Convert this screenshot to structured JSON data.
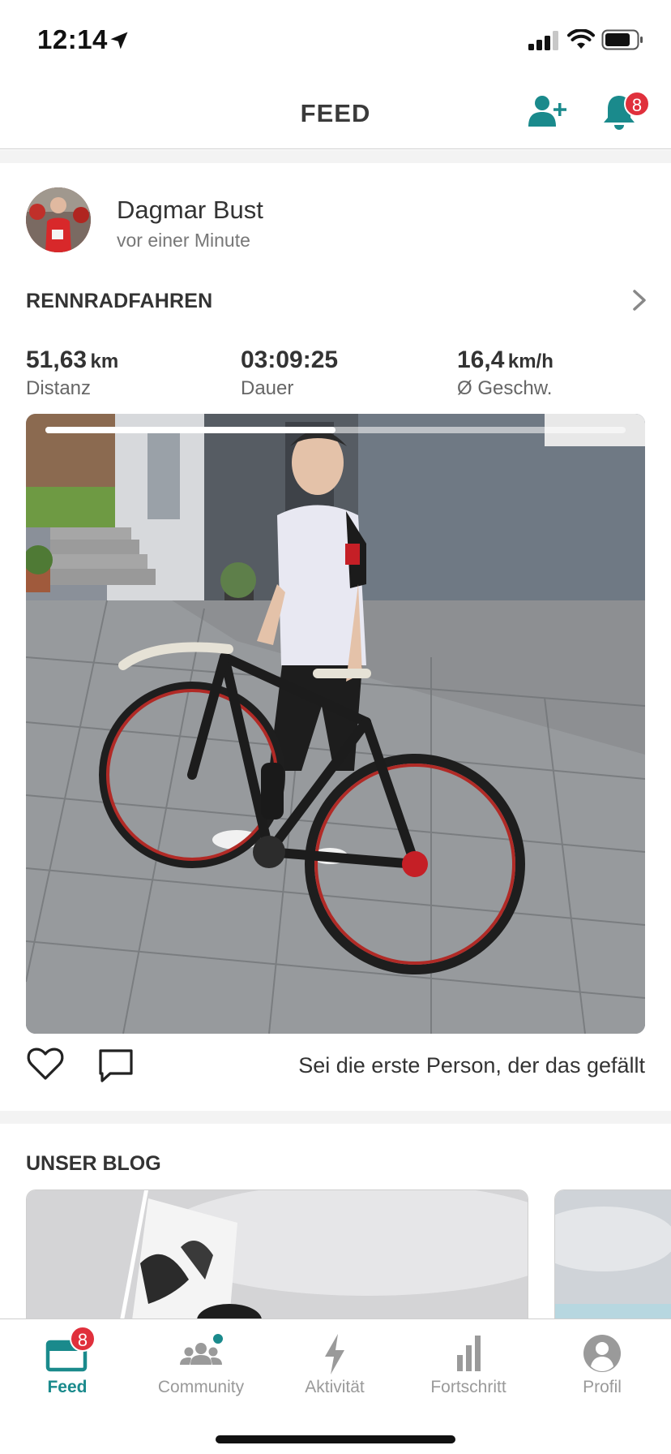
{
  "status_bar": {
    "time": "12:14"
  },
  "header": {
    "title": "FEED",
    "notification_count": "8"
  },
  "post": {
    "user_name": "Dagmar Bust",
    "time_ago": "vor einer Minute",
    "activity_type": "RENNRADFAHREN",
    "stats": [
      {
        "value": "51,63",
        "unit": "km",
        "label": "Distanz"
      },
      {
        "value": "03:09:25",
        "unit": "",
        "label": "Dauer"
      },
      {
        "value": "16,4",
        "unit": "km/h",
        "label": "Ø Geschw."
      }
    ],
    "carousel_progress": 0.5,
    "like_text": "Sei die erste Person, der das gefällt"
  },
  "blog": {
    "title": "UNSER BLOG"
  },
  "tabbar": {
    "accent_color": "#1a8a8c",
    "feed_badge": "8",
    "tabs": [
      {
        "label": "Feed",
        "icon": "feed-icon"
      },
      {
        "label": "Community",
        "icon": "community-icon"
      },
      {
        "label": "Aktivität",
        "icon": "lightning-icon"
      },
      {
        "label": "Fortschritt",
        "icon": "bar-chart-icon"
      },
      {
        "label": "Profil",
        "icon": "profile-icon"
      }
    ]
  }
}
